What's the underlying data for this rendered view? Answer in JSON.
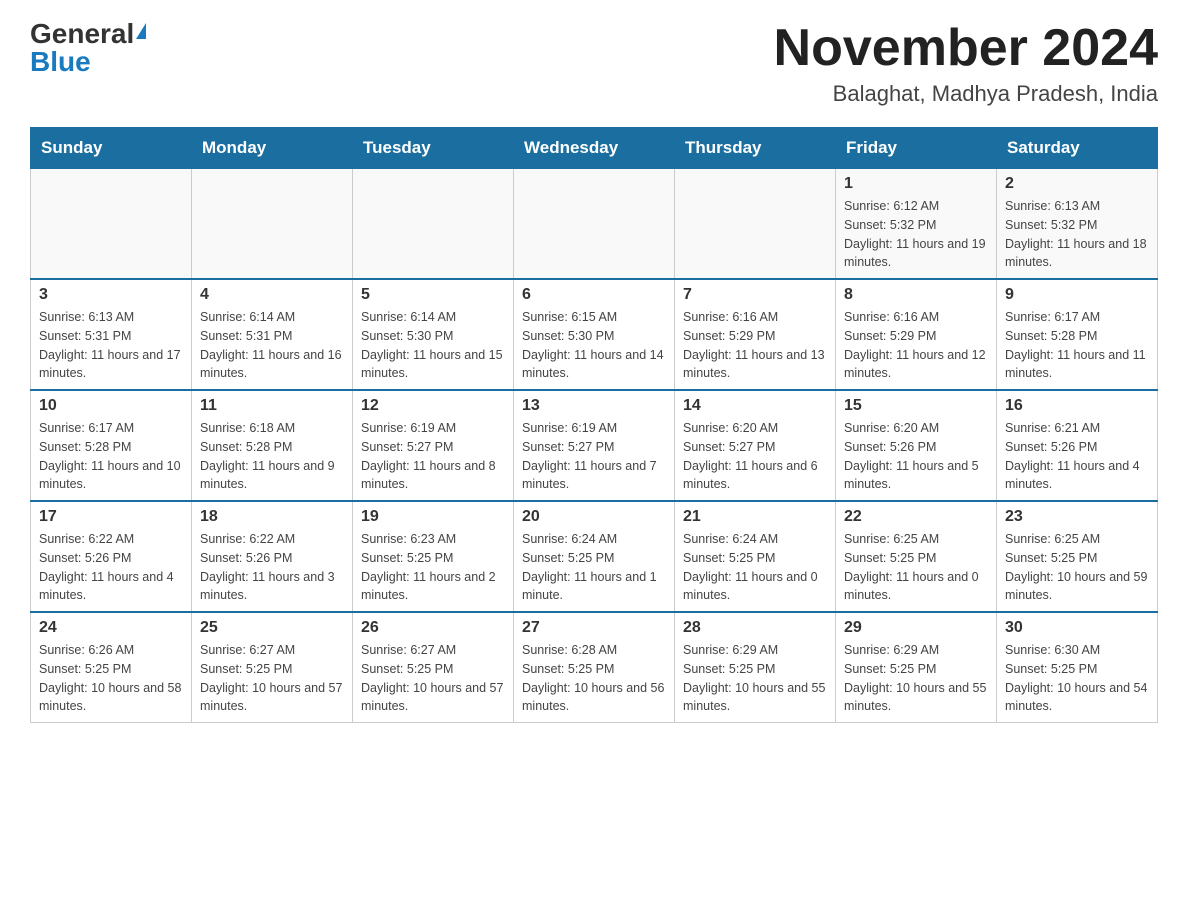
{
  "header": {
    "logo_general": "General",
    "logo_blue": "Blue",
    "month_title": "November 2024",
    "location": "Balaghat, Madhya Pradesh, India"
  },
  "days_of_week": [
    "Sunday",
    "Monday",
    "Tuesday",
    "Wednesday",
    "Thursday",
    "Friday",
    "Saturday"
  ],
  "weeks": [
    {
      "days": [
        {
          "num": "",
          "info": ""
        },
        {
          "num": "",
          "info": ""
        },
        {
          "num": "",
          "info": ""
        },
        {
          "num": "",
          "info": ""
        },
        {
          "num": "",
          "info": ""
        },
        {
          "num": "1",
          "info": "Sunrise: 6:12 AM\nSunset: 5:32 PM\nDaylight: 11 hours and 19 minutes."
        },
        {
          "num": "2",
          "info": "Sunrise: 6:13 AM\nSunset: 5:32 PM\nDaylight: 11 hours and 18 minutes."
        }
      ]
    },
    {
      "days": [
        {
          "num": "3",
          "info": "Sunrise: 6:13 AM\nSunset: 5:31 PM\nDaylight: 11 hours and 17 minutes."
        },
        {
          "num": "4",
          "info": "Sunrise: 6:14 AM\nSunset: 5:31 PM\nDaylight: 11 hours and 16 minutes."
        },
        {
          "num": "5",
          "info": "Sunrise: 6:14 AM\nSunset: 5:30 PM\nDaylight: 11 hours and 15 minutes."
        },
        {
          "num": "6",
          "info": "Sunrise: 6:15 AM\nSunset: 5:30 PM\nDaylight: 11 hours and 14 minutes."
        },
        {
          "num": "7",
          "info": "Sunrise: 6:16 AM\nSunset: 5:29 PM\nDaylight: 11 hours and 13 minutes."
        },
        {
          "num": "8",
          "info": "Sunrise: 6:16 AM\nSunset: 5:29 PM\nDaylight: 11 hours and 12 minutes."
        },
        {
          "num": "9",
          "info": "Sunrise: 6:17 AM\nSunset: 5:28 PM\nDaylight: 11 hours and 11 minutes."
        }
      ]
    },
    {
      "days": [
        {
          "num": "10",
          "info": "Sunrise: 6:17 AM\nSunset: 5:28 PM\nDaylight: 11 hours and 10 minutes."
        },
        {
          "num": "11",
          "info": "Sunrise: 6:18 AM\nSunset: 5:28 PM\nDaylight: 11 hours and 9 minutes."
        },
        {
          "num": "12",
          "info": "Sunrise: 6:19 AM\nSunset: 5:27 PM\nDaylight: 11 hours and 8 minutes."
        },
        {
          "num": "13",
          "info": "Sunrise: 6:19 AM\nSunset: 5:27 PM\nDaylight: 11 hours and 7 minutes."
        },
        {
          "num": "14",
          "info": "Sunrise: 6:20 AM\nSunset: 5:27 PM\nDaylight: 11 hours and 6 minutes."
        },
        {
          "num": "15",
          "info": "Sunrise: 6:20 AM\nSunset: 5:26 PM\nDaylight: 11 hours and 5 minutes."
        },
        {
          "num": "16",
          "info": "Sunrise: 6:21 AM\nSunset: 5:26 PM\nDaylight: 11 hours and 4 minutes."
        }
      ]
    },
    {
      "days": [
        {
          "num": "17",
          "info": "Sunrise: 6:22 AM\nSunset: 5:26 PM\nDaylight: 11 hours and 4 minutes."
        },
        {
          "num": "18",
          "info": "Sunrise: 6:22 AM\nSunset: 5:26 PM\nDaylight: 11 hours and 3 minutes."
        },
        {
          "num": "19",
          "info": "Sunrise: 6:23 AM\nSunset: 5:25 PM\nDaylight: 11 hours and 2 minutes."
        },
        {
          "num": "20",
          "info": "Sunrise: 6:24 AM\nSunset: 5:25 PM\nDaylight: 11 hours and 1 minute."
        },
        {
          "num": "21",
          "info": "Sunrise: 6:24 AM\nSunset: 5:25 PM\nDaylight: 11 hours and 0 minutes."
        },
        {
          "num": "22",
          "info": "Sunrise: 6:25 AM\nSunset: 5:25 PM\nDaylight: 11 hours and 0 minutes."
        },
        {
          "num": "23",
          "info": "Sunrise: 6:25 AM\nSunset: 5:25 PM\nDaylight: 10 hours and 59 minutes."
        }
      ]
    },
    {
      "days": [
        {
          "num": "24",
          "info": "Sunrise: 6:26 AM\nSunset: 5:25 PM\nDaylight: 10 hours and 58 minutes."
        },
        {
          "num": "25",
          "info": "Sunrise: 6:27 AM\nSunset: 5:25 PM\nDaylight: 10 hours and 57 minutes."
        },
        {
          "num": "26",
          "info": "Sunrise: 6:27 AM\nSunset: 5:25 PM\nDaylight: 10 hours and 57 minutes."
        },
        {
          "num": "27",
          "info": "Sunrise: 6:28 AM\nSunset: 5:25 PM\nDaylight: 10 hours and 56 minutes."
        },
        {
          "num": "28",
          "info": "Sunrise: 6:29 AM\nSunset: 5:25 PM\nDaylight: 10 hours and 55 minutes."
        },
        {
          "num": "29",
          "info": "Sunrise: 6:29 AM\nSunset: 5:25 PM\nDaylight: 10 hours and 55 minutes."
        },
        {
          "num": "30",
          "info": "Sunrise: 6:30 AM\nSunset: 5:25 PM\nDaylight: 10 hours and 54 minutes."
        }
      ]
    }
  ]
}
